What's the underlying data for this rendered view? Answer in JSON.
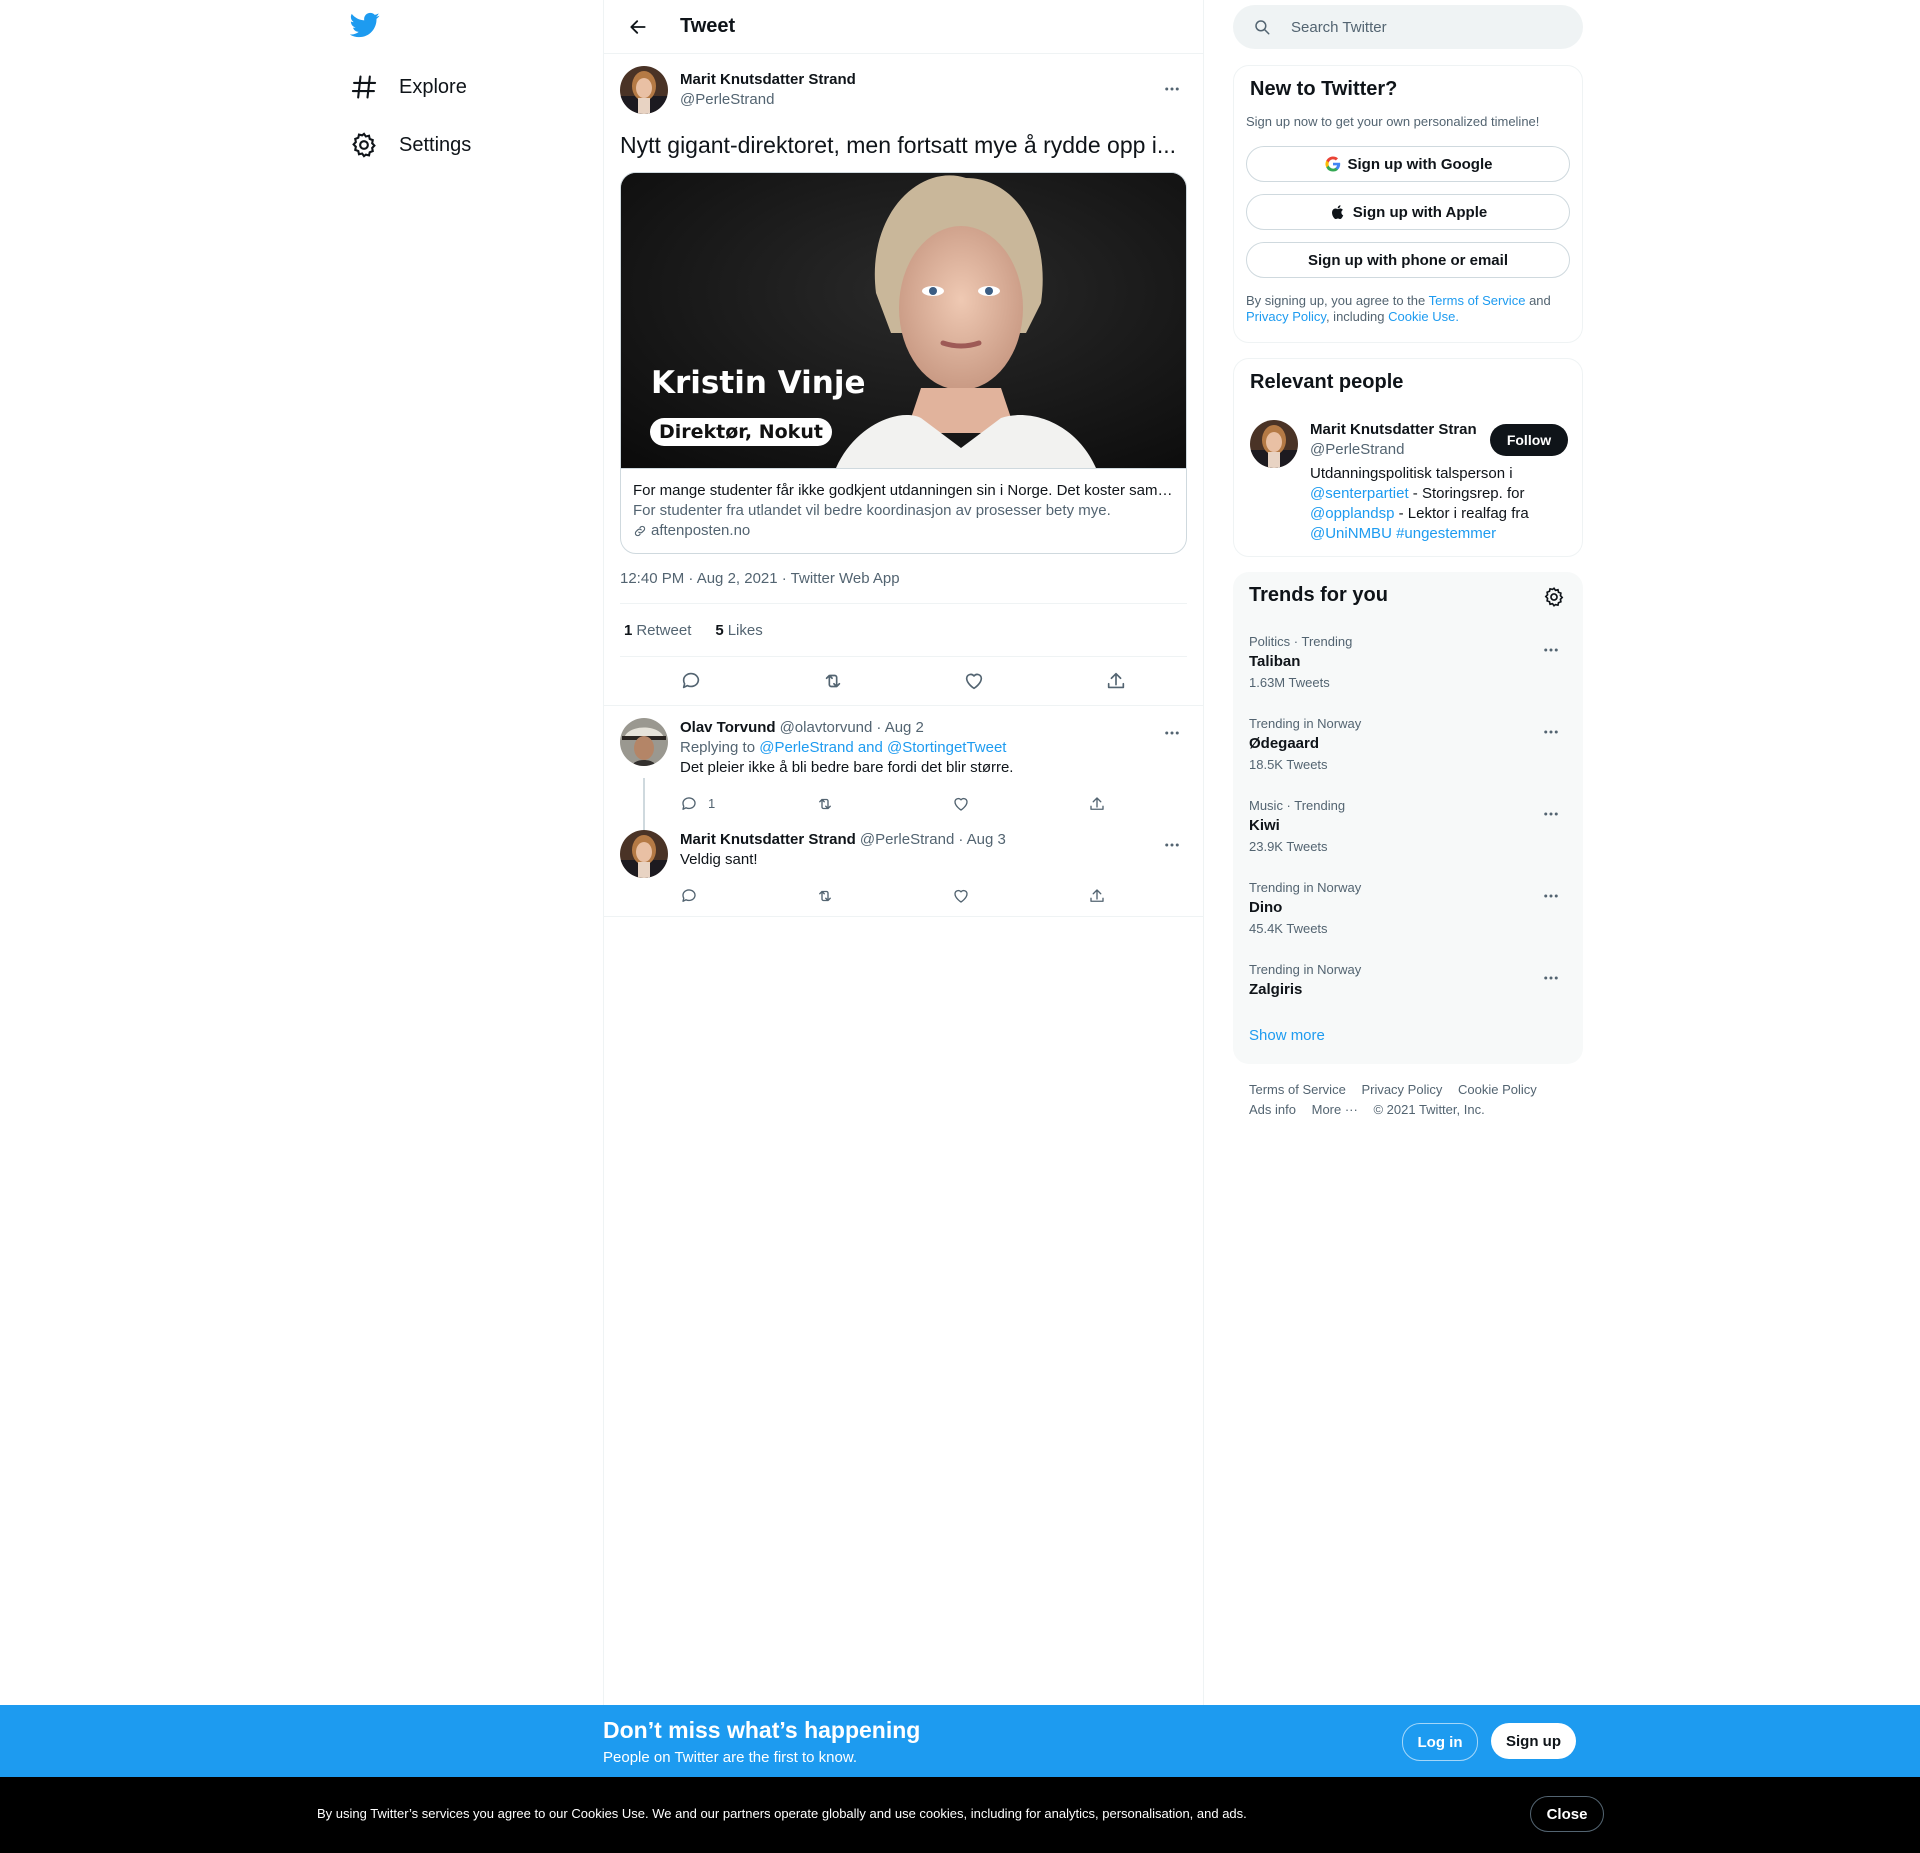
{
  "colors": {
    "accent": "#1d9bf0",
    "text": "#0f1419",
    "muted": "#536471",
    "border": "#eff3f4"
  },
  "nav": {
    "logo": "twitter-bird-icon",
    "items": [
      {
        "label": "Explore",
        "icon": "hashtag-icon"
      },
      {
        "label": "Settings",
        "icon": "gear-icon"
      }
    ]
  },
  "main": {
    "header_title": "Tweet",
    "tweet": {
      "author_name": "Marit Knutsdatter Strand",
      "author_handle": "@PerleStrand",
      "text": "Nytt gigant-direktoret, men fortsatt mye å rydde opp i...",
      "card": {
        "overlay_name": "Kristin Vinje",
        "overlay_title": "Direktør, Nokut",
        "title": "For mange studenter får ikke godkjent utdanningen sin i Norge. Det koster samf...",
        "description": "For studenter fra utlandet vil bedre koordinasjon av prosesser bety mye.",
        "domain": "aftenposten.no"
      },
      "meta": "12:40 PM · Aug 2, 2021 · Twitter Web App",
      "retweets_count": "1",
      "retweets_label": "Retweet",
      "likes_count": "5",
      "likes_label": "Likes"
    },
    "replies": [
      {
        "author_name": "Olav Torvund",
        "author_handle": "@olavtorvund",
        "date": "· Aug 2",
        "replying_prefix": "Replying to",
        "replying_to": "@PerleStrand and @StortingetTweet",
        "text": "Det pleier ikke å bli bedre bare fordi det blir større.",
        "reply_count": "1"
      },
      {
        "author_name": "Marit Knutsdatter Strand",
        "author_handle": "@PerleStrand",
        "date": "· Aug 3",
        "text": "Veldig sant!"
      }
    ]
  },
  "search": {
    "placeholder": "Search Twitter"
  },
  "signup": {
    "title": "New to Twitter?",
    "subtitle": "Sign up now to get your own personalized timeline!",
    "google": "Sign up with Google",
    "apple": "Sign up with Apple",
    "phone": "Sign up with phone or email",
    "legal_prefix": "By signing up, you agree to the",
    "terms": "Terms of Service",
    "and": "and",
    "privacy": "Privacy Policy",
    "including": ", including",
    "cookie": "Cookie Use."
  },
  "relevant": {
    "title": "Relevant people",
    "name": "Marit Knutsdatter Strand",
    "handle": "@PerleStrand",
    "follow": "Follow",
    "bio_1": "Utdanningspolitisk talsperson i",
    "bio_link_1": "@senterpartiet",
    "bio_2": "- Storingsrep. for",
    "bio_link_2": "@opplandsp",
    "bio_3": "- Lektor i realfag fra",
    "bio_link_3": "@UniNMBU #ungestemmer"
  },
  "trends": {
    "title": "Trends for you",
    "items": [
      {
        "category": "Politics · Trending",
        "name": "Taliban",
        "count": "1.63M Tweets"
      },
      {
        "category": "Trending in Norway",
        "name": "Ødegaard",
        "count": "18.5K Tweets"
      },
      {
        "category": "Music · Trending",
        "name": "Kiwi",
        "count": "23.9K Tweets"
      },
      {
        "category": "Trending in Norway",
        "name": "Dino",
        "count": "45.4K Tweets"
      },
      {
        "category": "Trending in Norway",
        "name": "Zalgiris",
        "count": ""
      }
    ],
    "show_more": "Show more"
  },
  "footer": {
    "terms": "Terms of Service",
    "privacy": "Privacy Policy",
    "cookie": "Cookie Policy",
    "ads": "Ads info",
    "more": "More ···",
    "copyright": "© 2021 Twitter, Inc."
  },
  "banner": {
    "title": "Don’t miss what’s happening",
    "subtitle": "People on Twitter are the first to know.",
    "login": "Log in",
    "signup": "Sign up"
  },
  "cookie": {
    "text": "By using Twitter’s services you agree to our Cookies Use. We and our partners operate globally and use cookies, including for analytics, personalisation, and ads.",
    "close": "Close"
  }
}
